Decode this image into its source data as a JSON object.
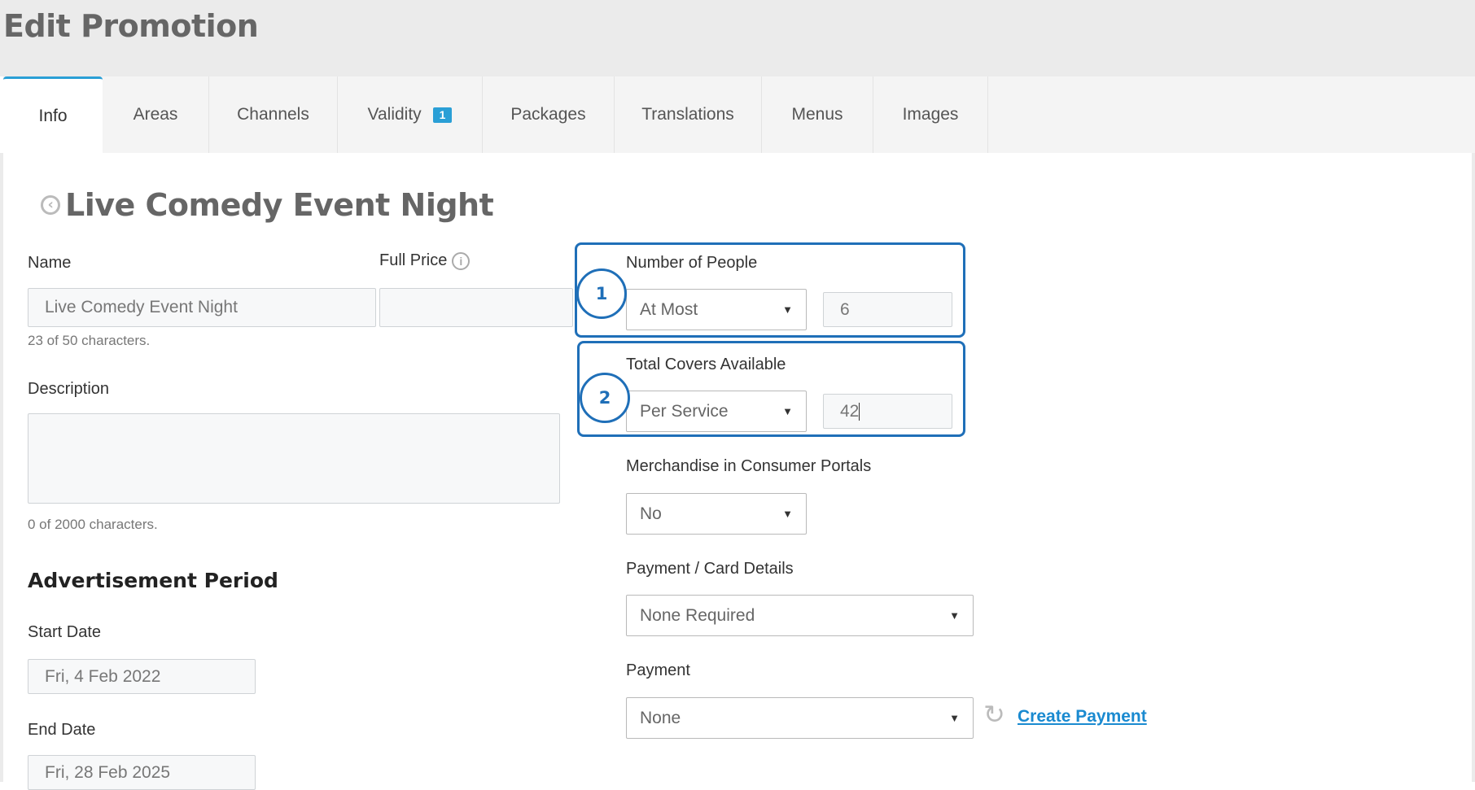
{
  "header": {
    "title": "Edit Promotion"
  },
  "tabs": [
    {
      "label": "Info"
    },
    {
      "label": "Areas"
    },
    {
      "label": "Channels"
    },
    {
      "label": "Validity",
      "badge": "1"
    },
    {
      "label": "Packages"
    },
    {
      "label": "Translations"
    },
    {
      "label": "Menus"
    },
    {
      "label": "Images"
    }
  ],
  "promotion": {
    "title": "Live Comedy Event Night"
  },
  "form": {
    "name_label": "Name",
    "name_value": "Live Comedy Event Night",
    "name_hint": "23 of 50 characters.",
    "full_price_label": "Full Price",
    "full_price_value": "",
    "description_label": "Description",
    "description_value": "",
    "description_hint": "0 of 2000 characters.",
    "ad_period_title": "Advertisement Period",
    "start_date_label": "Start Date",
    "start_date_value": "Fri, 4 Feb 2022",
    "end_date_label": "End Date",
    "end_date_value": "Fri, 28 Feb 2025",
    "people_label": "Number of People",
    "people_mode": "At Most",
    "people_value": "6",
    "covers_label": "Total Covers Available",
    "covers_mode": "Per Service",
    "covers_value": "42",
    "merch_label": "Merchandise in Consumer Portals",
    "merch_value": "No",
    "card_label": "Payment / Card Details",
    "card_value": "None Required",
    "payment_label": "Payment",
    "payment_value": "None",
    "create_payment_link": "Create Payment"
  },
  "annotations": [
    "1",
    "2"
  ],
  "colors": {
    "accent": "#2a9fd6",
    "annotation": "#1f6fb8",
    "link": "#1a8ad0"
  },
  "icons": {
    "back": "circle-chevron-left-icon",
    "info": "info-icon",
    "refresh": "refresh-icon",
    "dropdown": "caret-down-icon"
  }
}
